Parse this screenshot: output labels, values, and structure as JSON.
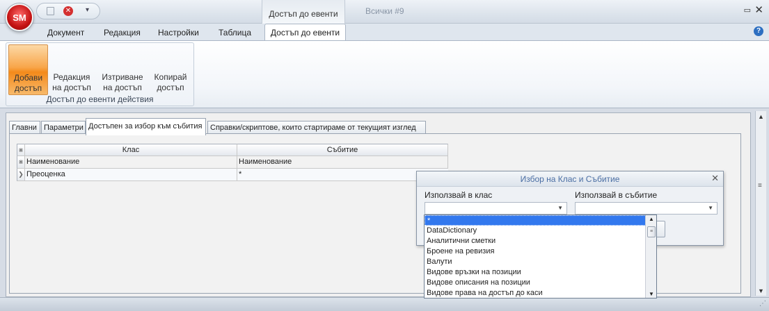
{
  "app": {
    "logo_text": "SM",
    "title_tab": "Достъп до евенти",
    "document_title": "Всички #9"
  },
  "menu": {
    "items": [
      "Документ",
      "Редакция",
      "Настройки",
      "Таблица"
    ],
    "active": "Достъп до евенти"
  },
  "ribbon": {
    "buttons": [
      {
        "line1": "Добави",
        "line2": "достъп"
      },
      {
        "line1": "Редакция",
        "line2": "на достъп"
      },
      {
        "line1": "Изтриване",
        "line2": "на достъп"
      },
      {
        "line1": "Копирай",
        "line2": "достъп"
      }
    ],
    "group_label": "Достъп до евенти действия"
  },
  "tabs": [
    "Главни",
    "Параметри",
    "Достъпен за избор към събития",
    "Справки/скриптове, които стартираме от текущият изглед"
  ],
  "grid": {
    "headers": [
      "Клас",
      "Събитие"
    ],
    "filter_row": [
      "Наименование",
      "Наименование"
    ],
    "rows": [
      {
        "class": "Преоценка",
        "event": "*"
      }
    ]
  },
  "dialog": {
    "title": "Избор на Клас и Събитие",
    "label_class": "Използвай в клас",
    "label_event": "Използвай в събитие",
    "class_value": "",
    "event_value": ""
  },
  "dropdown": {
    "selected": "*",
    "items": [
      "DataDictionary",
      "Аналитични сметки",
      "Броене на ревизия",
      "Валути",
      "Видове връзки на позиции",
      "Видове описания на позиции",
      "Видове права на достъп до каси"
    ]
  }
}
